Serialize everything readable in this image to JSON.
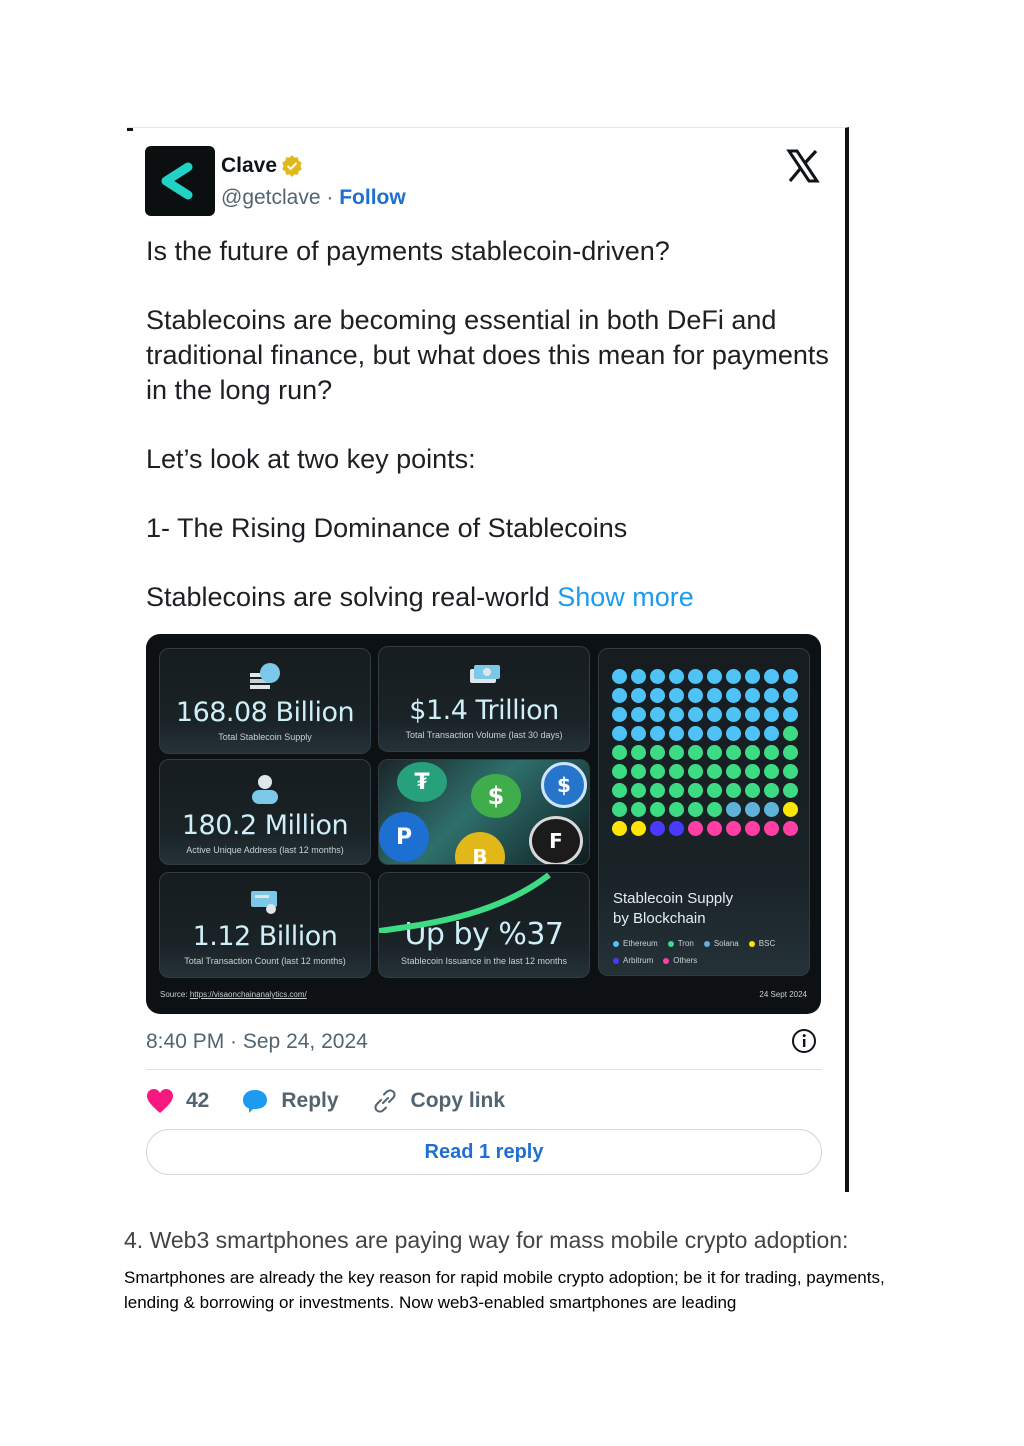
{
  "tweet": {
    "author_name": "Clave",
    "author_handle": "@getclave",
    "separator": "·",
    "follow_label": "Follow",
    "paragraphs": [
      "Is the future of payments stablecoin-driven?",
      "Stablecoins are becoming essential in both DeFi and traditional finance, but what does this mean for payments in the long run?",
      "Let’s look at two key points:",
      "1- The Rising Dominance of Stablecoins"
    ],
    "truncated_text": "Stablecoins are solving real-world",
    "show_more_label": "Show more",
    "timestamp": "8:40 PM · Sep 24, 2024",
    "likes_count": "42",
    "reply_label": "Reply",
    "copy_link_label": "Copy link",
    "read_reply_label": "Read 1 reply"
  },
  "infographic": {
    "stats": [
      {
        "value": "168.08 Billion",
        "label": "Total Stablecoin Supply"
      },
      {
        "value": "$1.4 Trillion",
        "label": "Total Transaction Volume (last 30 days)"
      },
      {
        "value": "180.2 Million",
        "label": "Active Unique Address (last 12 months)"
      },
      {
        "value": "1.12 Billion",
        "label": "Total Transaction Count (last 12 months)"
      },
      {
        "value": "Up by %37",
        "label": "Stablecoin Issuance in the last 12 months"
      }
    ],
    "supply_title_line1": "Stablecoin Supply",
    "supply_title_line2": "by Blockchain",
    "legend": [
      {
        "name": "Ethereum",
        "color": "#4fc3f7"
      },
      {
        "name": "Tron",
        "color": "#3ddc84"
      },
      {
        "name": "Solana",
        "color": "#5fb3d9"
      },
      {
        "name": "BSC",
        "color": "#ffe600"
      },
      {
        "name": "Arbitrum",
        "color": "#4a3aff"
      },
      {
        "name": "Others",
        "color": "#ff3fa4"
      }
    ],
    "dot_grid": {
      "columns": 10,
      "rows": [
        [
          "#4fc3f7",
          "#4fc3f7",
          "#4fc3f7",
          "#4fc3f7",
          "#4fc3f7",
          "#4fc3f7",
          "#4fc3f7",
          "#4fc3f7",
          "#4fc3f7",
          "#4fc3f7"
        ],
        [
          "#4fc3f7",
          "#4fc3f7",
          "#4fc3f7",
          "#4fc3f7",
          "#4fc3f7",
          "#4fc3f7",
          "#4fc3f7",
          "#4fc3f7",
          "#4fc3f7",
          "#4fc3f7"
        ],
        [
          "#4fc3f7",
          "#4fc3f7",
          "#4fc3f7",
          "#4fc3f7",
          "#4fc3f7",
          "#4fc3f7",
          "#4fc3f7",
          "#4fc3f7",
          "#4fc3f7",
          "#4fc3f7"
        ],
        [
          "#4fc3f7",
          "#4fc3f7",
          "#4fc3f7",
          "#4fc3f7",
          "#4fc3f7",
          "#4fc3f7",
          "#4fc3f7",
          "#4fc3f7",
          "#4fc3f7",
          "#3ddc84"
        ],
        [
          "#3ddc84",
          "#3ddc84",
          "#3ddc84",
          "#3ddc84",
          "#3ddc84",
          "#3ddc84",
          "#3ddc84",
          "#3ddc84",
          "#3ddc84",
          "#3ddc84"
        ],
        [
          "#3ddc84",
          "#3ddc84",
          "#3ddc84",
          "#3ddc84",
          "#3ddc84",
          "#3ddc84",
          "#3ddc84",
          "#3ddc84",
          "#3ddc84",
          "#3ddc84"
        ],
        [
          "#3ddc84",
          "#3ddc84",
          "#3ddc84",
          "#3ddc84",
          "#3ddc84",
          "#3ddc84",
          "#3ddc84",
          "#3ddc84",
          "#3ddc84",
          "#3ddc84"
        ],
        [
          "#3ddc84",
          "#3ddc84",
          "#3ddc84",
          "#3ddc84",
          "#3ddc84",
          "#3ddc84",
          "#5fb3d9",
          "#5fb3d9",
          "#5fb3d9",
          "#ffe600"
        ],
        [
          "#ffe600",
          "#ffe600",
          "#4a3aff",
          "#4a3aff",
          "#ff3fa4",
          "#ff3fa4",
          "#ff3fa4",
          "#ff3fa4",
          "#ff3fa4",
          "#ff3fa4"
        ]
      ]
    },
    "source_label": "Source:",
    "source_url": "https://visaonchainanalytics.com/",
    "date": "24 Sept 2024"
  },
  "document": {
    "heading": "4. Web3 smartphones are paying way for mass mobile crypto adoption:",
    "paragraph": "Smartphones are already the key reason for rapid mobile crypto adoption; be it for trading, payments, lending & borrowing or investments. Now web3-enabled smartphones are leading"
  },
  "colors": {
    "accent": "#1d9bf0",
    "follow": "#1d6fd1",
    "like": "#f91880",
    "reply_bubble": "#1d9bf0"
  }
}
